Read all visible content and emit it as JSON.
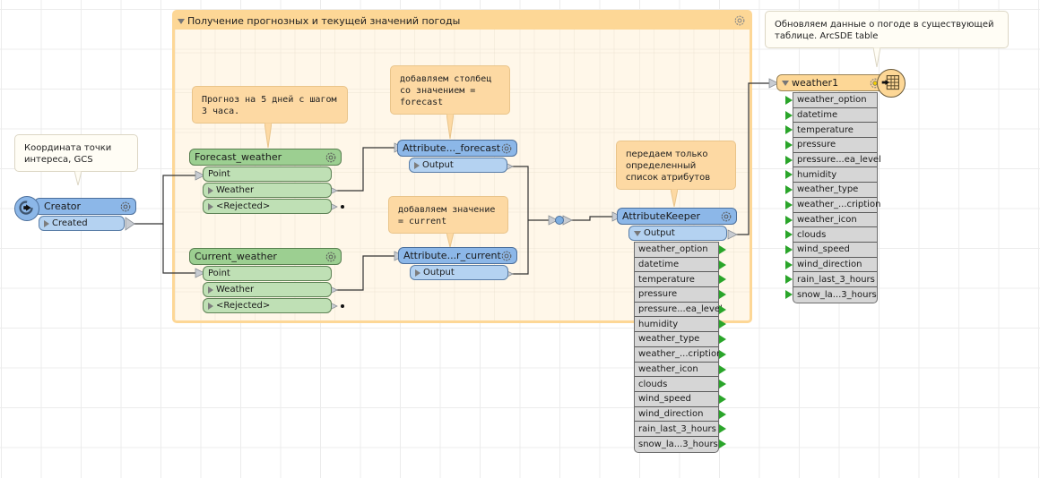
{
  "bookmark": {
    "title": "Получение прогнозных и текущей значений погоды"
  },
  "annotations": {
    "creator_note": "Координата точки интереса, GCS",
    "forecast_note": "Прогноз на 5 дней с шагом 3 часа.",
    "attr_forecast_note": "добавляем столбец со значением = forecast",
    "attr_current_note": "добавляем значение = current",
    "keeper_note": "передаем только определенный список атрибутов",
    "writer_note": "Обновляем данные о погоде в существующей таблице. ArcSDE table"
  },
  "creator": {
    "name": "Creator",
    "output": "Created"
  },
  "forecast_weather": {
    "name": "Forecast_weather",
    "input": "Point",
    "outputs": [
      "Weather",
      "<Rejected>"
    ]
  },
  "current_weather": {
    "name": "Current_weather",
    "input": "Point",
    "outputs": [
      "Weather",
      "<Rejected>"
    ]
  },
  "attr_forecast": {
    "name": "Attribute..._forecast",
    "output": "Output"
  },
  "attr_current": {
    "name": "Attribute...r_current",
    "output": "Output"
  },
  "attribute_keeper": {
    "name": "AttributeKeeper",
    "output": "Output",
    "attributes": [
      "weather_option",
      "datetime",
      "temperature",
      "pressure",
      "pressure...ea_level",
      "humidity",
      "weather_type",
      "weather_...cription",
      "weather_icon",
      "clouds",
      "wind_speed",
      "wind_direction",
      "rain_last_3_hours",
      "snow_la...3_hours"
    ]
  },
  "writer": {
    "name": "weather1",
    "attributes": [
      "weather_option",
      "datetime",
      "temperature",
      "pressure",
      "pressure...ea_level",
      "humidity",
      "weather_type",
      "weather_...cription",
      "weather_icon",
      "clouds",
      "wind_speed",
      "wind_direction",
      "rain_last_3_hours",
      "snow_la...3_hours"
    ]
  },
  "colors": {
    "bookmark": "#fdd796",
    "transformer_blue": "#8cb7e8",
    "transformer_green": "#9ccf91",
    "writer": "#fdd796",
    "annotation": "#fdd9a3",
    "port_arrow_green": "#2aa52a"
  }
}
